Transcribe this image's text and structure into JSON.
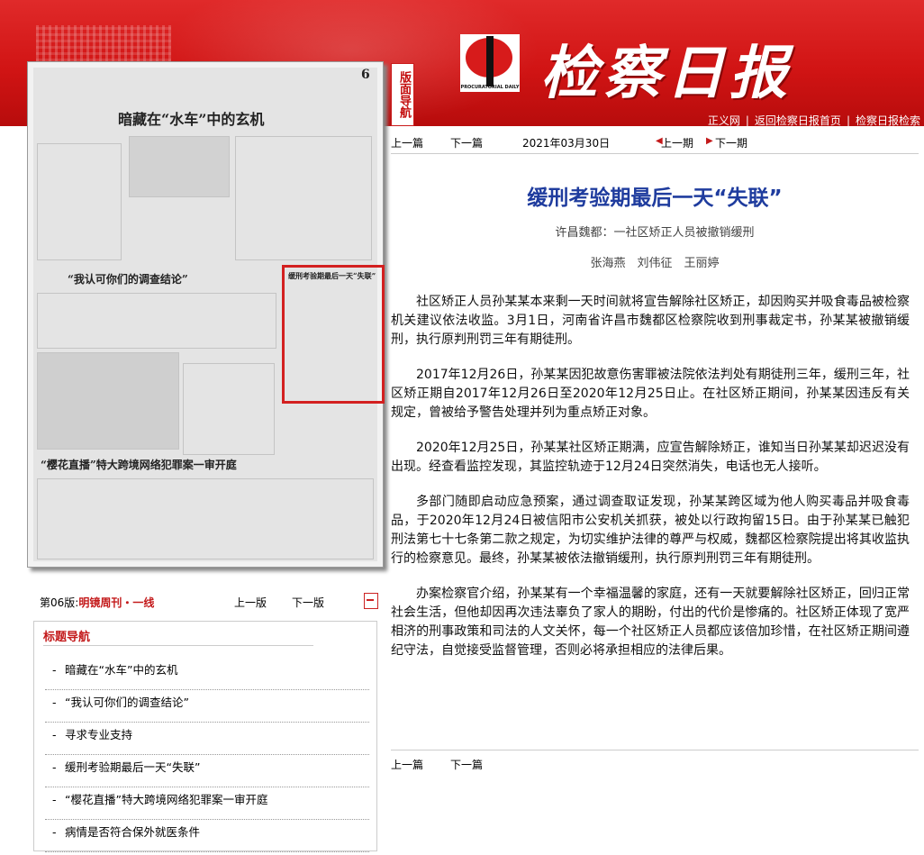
{
  "header": {
    "banner_label": "版面导航",
    "masthead": "检察日报",
    "logo_caption": "PROCURATORIAL DAILY",
    "links": [
      "正义网",
      "返回检察日报首页",
      "检察日报检索"
    ]
  },
  "left": {
    "page_label": "第06版:",
    "page_name": "明镜周刊・一线",
    "prev": "上一版",
    "next": "下一版",
    "toc_title": "标题导航",
    "toc_items": [
      "暗藏在“水车”中的玄机",
      "“我认可你们的调查结论”",
      "寻求专业支持",
      "缓刑考验期最后一天“失联”",
      "“樱花直播”特大跨境网络犯罪案一审开庭",
      "病情是否符合保外就医条件"
    ]
  },
  "right": {
    "nav": {
      "prev_article": "上一篇",
      "next_article": "下一篇",
      "date": "2021年03月30日",
      "prev_issue": "上一期",
      "next_issue": "下一期"
    },
    "title": "缓刑考验期最后一天“失联”",
    "subtitle": "许昌魏都：一社区矫正人员被撤销缓刑",
    "authors": "张海燕　刘伟征　王丽婷",
    "paragraphs": [
      "社区矫正人员孙某某本来剩一天时间就将宣告解除社区矫正，却因购买并吸食毒品被检察机关建议依法收监。3月1日，河南省许昌市魏都区检察院收到刑事裁定书，孙某某被撤销缓刑，执行原判刑罚三年有期徒刑。",
      "2017年12月26日，孙某某因犯故意伤害罪被法院依法判处有期徒刑三年，缓刑三年，社区矫正期自2017年12月26日至2020年12月25日止。在社区矫正期间，孙某某因违反有关规定，曾被给予警告处理并列为重点矫正对象。",
      "2020年12月25日，孙某某社区矫正期满，应宣告解除矫正，谁知当日孙某某却迟迟没有出现。经查看监控发现，其监控轨迹于12月24日突然消失，电话也无人接听。",
      "多部门随即启动应急预案，通过调查取证发现，孙某某跨区域为他人购买毒品并吸食毒品，于2020年12月24日被信阳市公安机关抓获，被处以行政拘留15日。由于孙某某已触犯刑法第七十七条第二款之规定，为切实维护法律的尊严与权威，魏都区检察院提出将其收监执行的检察意见。最终，孙某某被依法撤销缓刑，执行原判刑罚三年有期徒刑。",
      "办案检察官介绍，孙某某有一个幸福温馨的家庭，还有一天就要解除社区矫正，回归正常社会生活，但他却因再次违法辜负了家人的期盼，付出的代价是惨痛的。社区矫正体现了宽严相济的刑事政策和司法的人文关怀，每一个社区矫正人员都应该倍加珍惜，在社区矫正期间遵纪守法，自觉接受监督管理，否则必将承担相应的法律后果。"
    ],
    "bottom_nav": {
      "prev_article": "上一篇",
      "next_article": "下一篇"
    }
  },
  "thumbnail": {
    "headline1": "暗藏在“水车”中的玄机",
    "headline2": "“我认可你们的调查结论”",
    "headline3": "“樱花直播”特大跨境网络犯罪案一审开庭",
    "page_number": "6",
    "box_title": "缓刑考验期最后一天“失联”"
  }
}
